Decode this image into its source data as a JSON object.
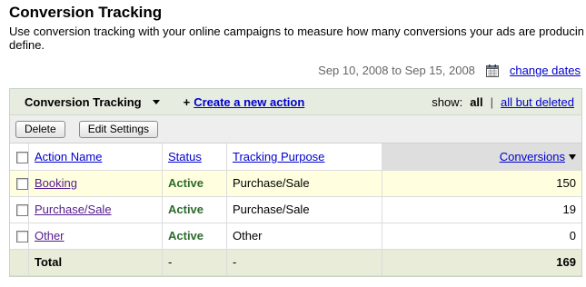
{
  "page": {
    "title": "Conversion Tracking",
    "description_line1": "Use conversion tracking with your online campaigns to measure how many conversions your ads are producing",
    "description_line2": "define."
  },
  "date_bar": {
    "range": "Sep 10, 2008 to Sep 15, 2008",
    "icon": "calendar-icon",
    "change_link": "change dates"
  },
  "panel": {
    "dropdown_label": "Conversion Tracking",
    "create_prefix": "+",
    "create_link": "Create a new action",
    "show_label": "show:",
    "show_all": "all",
    "show_sep": "|",
    "show_all_but_deleted": "all but deleted"
  },
  "toolbar": {
    "delete_label": "Delete",
    "edit_label": "Edit Settings"
  },
  "table": {
    "headers": {
      "action_name": "Action Name",
      "status": "Status",
      "tracking_purpose": "Tracking Purpose",
      "conversions": "Conversions"
    },
    "rows": [
      {
        "name": "Booking",
        "status": "Active",
        "purpose": "Purchase/Sale",
        "conversions": "150"
      },
      {
        "name": "Purchase/Sale",
        "status": "Active",
        "purpose": "Purchase/Sale",
        "conversions": "19"
      },
      {
        "name": "Other",
        "status": "Active",
        "purpose": "Other",
        "conversions": "0"
      }
    ],
    "total": {
      "label": "Total",
      "status": "-",
      "purpose": "-",
      "conversions": "169"
    }
  },
  "colors": {
    "link": "#0000cc",
    "visited_link": "#551a8b",
    "active_status": "#2d6b2d",
    "highlight_row": "#ffffe0",
    "panel_header": "#e6ecdf",
    "total_row": "#e9ecd9"
  }
}
